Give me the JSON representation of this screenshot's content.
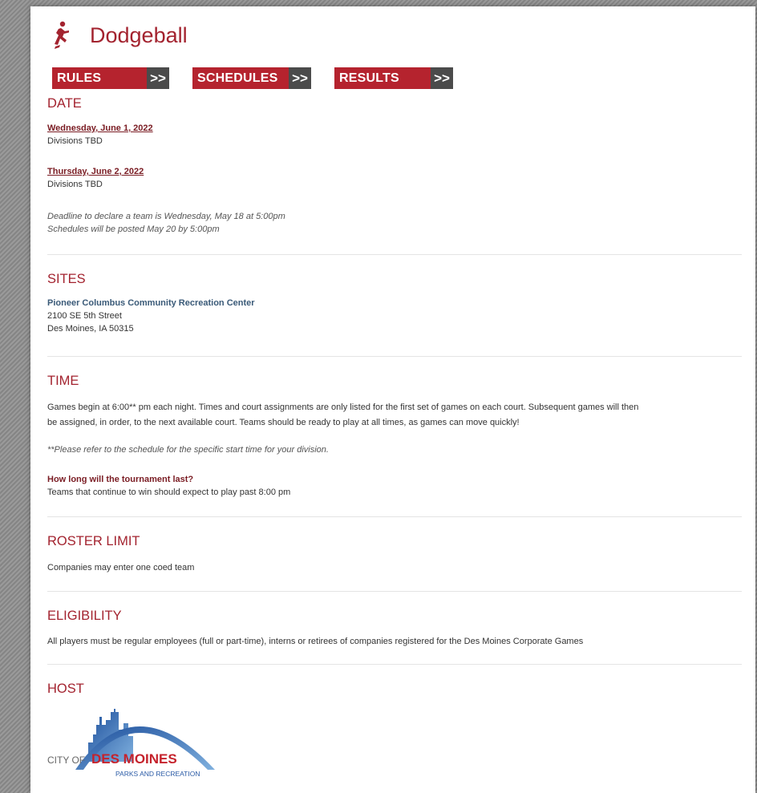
{
  "page_title": "Dodgeball",
  "nav": [
    {
      "label": "RULES",
      "arrow": ">>"
    },
    {
      "label": "SCHEDULES",
      "arrow": ">>"
    },
    {
      "label": "RESULTS",
      "arrow": ">>"
    }
  ],
  "date": {
    "heading": "DATE",
    "entries": [
      {
        "day": "Wednesday, June 1, 2022",
        "detail": "Divisions TBD"
      },
      {
        "day": "Thursday, June 2, 2022",
        "detail": "Divisions TBD"
      }
    ],
    "note1": "Deadline to declare a team is Wednesday, May 18 at 5:00pm",
    "note2": "Schedules will be posted May 20 by 5:00pm"
  },
  "sites": {
    "heading": "SITES",
    "name": "Pioneer Columbus Community Recreation Center",
    "street": "2100 SE 5th Street",
    "city": "Des Moines, IA 50315"
  },
  "time": {
    "heading": "TIME",
    "line1": "Games begin at 6:00** pm each night.  Times and court assignments are only listed for the first set of games on each court.  Subsequent games will then",
    "line2": "be assigned, in order, to the next available court.  Teams should be ready to play at all times, as games can move quickly!",
    "footnote": "**Please refer to the schedule for the specific start time for your division.",
    "question": "How long will the tournament last?",
    "answer": "Teams that continue to win should expect to play past 8:00 pm"
  },
  "roster": {
    "heading": "ROSTER LIMIT",
    "text": "Companies may enter one coed team"
  },
  "eligibility": {
    "heading": "ELIGIBILITY",
    "text": "All players must be regular employees (full or part-time), interns or retirees of companies registered for the Des Moines Corporate Games"
  },
  "host": {
    "heading": "HOST",
    "logo_line1_a": "CITY OF",
    "logo_line1_b": "DES MOINES",
    "logo_line2": "PARKS AND RECREATION"
  },
  "colors": {
    "accent": "#a3232f",
    "button": "#b5232e",
    "arrow_bg": "#4b4b4b"
  }
}
